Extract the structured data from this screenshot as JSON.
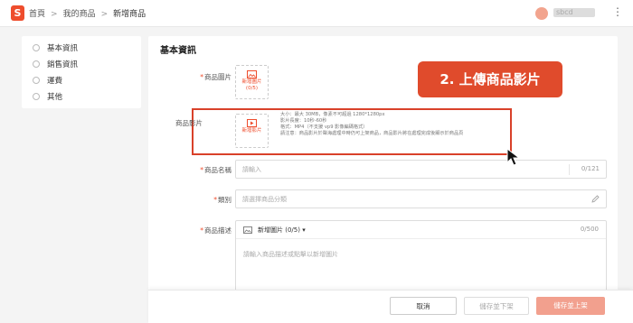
{
  "header": {
    "logo_letter": "S",
    "breadcrumb": [
      "首頁",
      "我的商品",
      "新增商品"
    ],
    "username": "sbcd",
    "more": "⋮"
  },
  "sidebar": {
    "items": [
      {
        "label": "基本資訊"
      },
      {
        "label": "銷售資訊"
      },
      {
        "label": "運費"
      },
      {
        "label": "其他"
      }
    ]
  },
  "main": {
    "section_title": "基本資訊",
    "product_images": {
      "label": "商品圖片",
      "upload_label": "新增圖片",
      "count": "(0/5)"
    },
    "product_video": {
      "label": "商品影片",
      "upload_label": "新增影片",
      "notes": [
        "大小：最大 30MB，像素不可超過 1280*1280px",
        "影片長度：10秒-60秒",
        "格式：MP4（不支援 vp9 影像編碼格式）",
        "請注意：商品影片於聲海處理中時仍可上架商品，商品影片將在處理完成後顯示於商品頁"
      ]
    },
    "product_name": {
      "label": "商品名稱",
      "placeholder": "請輸入",
      "count": "0/121"
    },
    "category": {
      "label": "類別",
      "placeholder": "請選擇商品分類"
    },
    "description": {
      "label": "商品描述",
      "add_image": "新增圖片 (0/5)",
      "count": "0/500",
      "placeholder": "請輸入商品描述或點擊以新增圖片"
    }
  },
  "annotation": {
    "callout_text": "2. 上傳商品影片",
    "accent": "#e04b2c"
  },
  "actions": {
    "cancel": "取消",
    "save_hide": "儲存並下架",
    "save_publish": "儲存並上架"
  },
  "colors": {
    "brand": "#ee4d2d",
    "publish_button": "#f2a08e"
  }
}
